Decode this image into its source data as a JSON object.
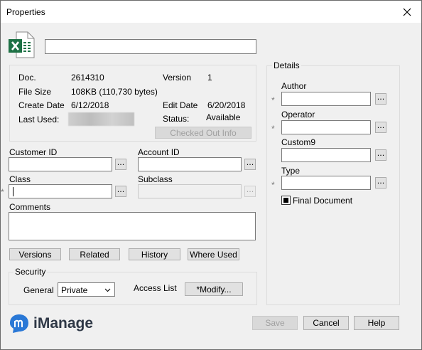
{
  "window": {
    "title": "Properties"
  },
  "file_info": {
    "doc_label": "Doc.",
    "doc_value": "2614310",
    "version_label": "Version",
    "version_value": "1",
    "file_size_label": "File Size",
    "file_size_value": "108KB (110,730 bytes)",
    "create_date_label": "Create Date",
    "create_date_value": "6/12/2018",
    "edit_date_label": "Edit Date",
    "edit_date_value": "6/20/2018",
    "last_used_label": "Last Used:",
    "status_label": "Status:",
    "status_value": "Available",
    "checked_out_button": "Checked Out Info"
  },
  "fields": {
    "customer_id_label": "Customer ID",
    "account_id_label": "Account ID",
    "class_label": "Class",
    "subclass_label": "Subclass",
    "comments_label": "Comments"
  },
  "buttons": {
    "versions": "Versions",
    "related": "Related",
    "history": "History",
    "where_used": "Where Used",
    "dots": "...",
    "save": "Save",
    "cancel": "Cancel",
    "help": "Help",
    "modify": "*Modify..."
  },
  "security": {
    "label": "Security",
    "general_label": "General",
    "general_value": "Private",
    "access_list_label": "Access List"
  },
  "details": {
    "label": "Details",
    "author_label": "Author",
    "operator_label": "Operator",
    "custom9_label": "Custom9",
    "type_label": "Type",
    "final_document_label": "Final Document",
    "required_marker": "*"
  },
  "brand": {
    "name": "iManage"
  },
  "colors": {
    "excel_green": "#1e7145",
    "imanage_blue": "#2a78d6"
  }
}
